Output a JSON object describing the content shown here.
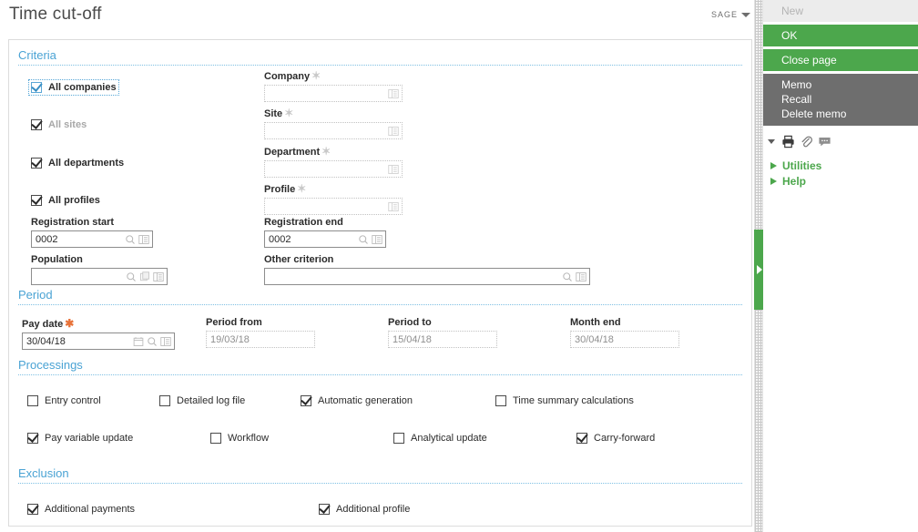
{
  "header": {
    "title": "Time cut-off",
    "brand": "SAGE"
  },
  "sections": {
    "criteria": {
      "title": "Criteria"
    },
    "period": {
      "title": "Period"
    },
    "processings": {
      "title": "Processings"
    },
    "exclusion": {
      "title": "Exclusion"
    }
  },
  "criteria": {
    "checkboxes": [
      {
        "label": "All companies",
        "checked": true,
        "disabled": false,
        "focused": true
      },
      {
        "label": "All sites",
        "checked": true,
        "disabled": true,
        "focused": false
      },
      {
        "label": "All departments",
        "checked": true,
        "disabled": false,
        "focused": false
      },
      {
        "label": "All profiles",
        "checked": true,
        "disabled": false,
        "focused": false
      }
    ],
    "lookups": [
      {
        "label": "Company",
        "value": "",
        "optional_marker": "★"
      },
      {
        "label": "Site",
        "value": "",
        "optional_marker": "★"
      },
      {
        "label": "Department",
        "value": "",
        "optional_marker": "★"
      },
      {
        "label": "Profile",
        "value": "",
        "optional_marker": "★"
      }
    ],
    "registration_start": {
      "label": "Registration start",
      "value": "0002"
    },
    "registration_end": {
      "label": "Registration end",
      "value": "0002"
    },
    "population": {
      "label": "Population",
      "value": ""
    },
    "other_criterion": {
      "label": "Other criterion",
      "value": ""
    }
  },
  "period": {
    "pay_date": {
      "label": "Pay date",
      "value": "30/04/18",
      "required_marker": "✱"
    },
    "period_from": {
      "label": "Period from",
      "value": "19/03/18"
    },
    "period_to": {
      "label": "Period to",
      "value": "15/04/18"
    },
    "month_end": {
      "label": "Month end",
      "value": "30/04/18"
    }
  },
  "processings": {
    "row1": [
      {
        "label": "Entry control",
        "checked": false
      },
      {
        "label": "Detailed log file",
        "checked": false
      },
      {
        "label": "Automatic generation",
        "checked": true
      },
      {
        "label": "Time summary calculations",
        "checked": false
      }
    ],
    "row2": [
      {
        "label": "Pay variable update",
        "checked": true
      },
      {
        "label": "Workflow",
        "checked": false
      },
      {
        "label": "Analytical update",
        "checked": false
      },
      {
        "label": "Carry-forward",
        "checked": true
      }
    ]
  },
  "exclusion": {
    "items": [
      {
        "label": "Additional payments",
        "checked": true
      },
      {
        "label": "Additional profile",
        "checked": true
      }
    ]
  },
  "right_panel": {
    "buttons": [
      {
        "label": "New",
        "state": "disabled"
      },
      {
        "label": "OK",
        "state": "primary"
      },
      {
        "label": "Close page",
        "state": "primary"
      }
    ],
    "memo_items": [
      "Memo",
      "Recall",
      "Delete memo"
    ],
    "icons": [
      "dropdown-caret-icon",
      "print-icon",
      "attachment-icon",
      "comment-icon"
    ],
    "menu": [
      "Utilities",
      "Help"
    ]
  },
  "colors": {
    "accent_green": "#4ca74c",
    "section_blue": "#4aa3d4",
    "memo_grey": "#6e6e6e",
    "required_orange": "#e8733a"
  }
}
